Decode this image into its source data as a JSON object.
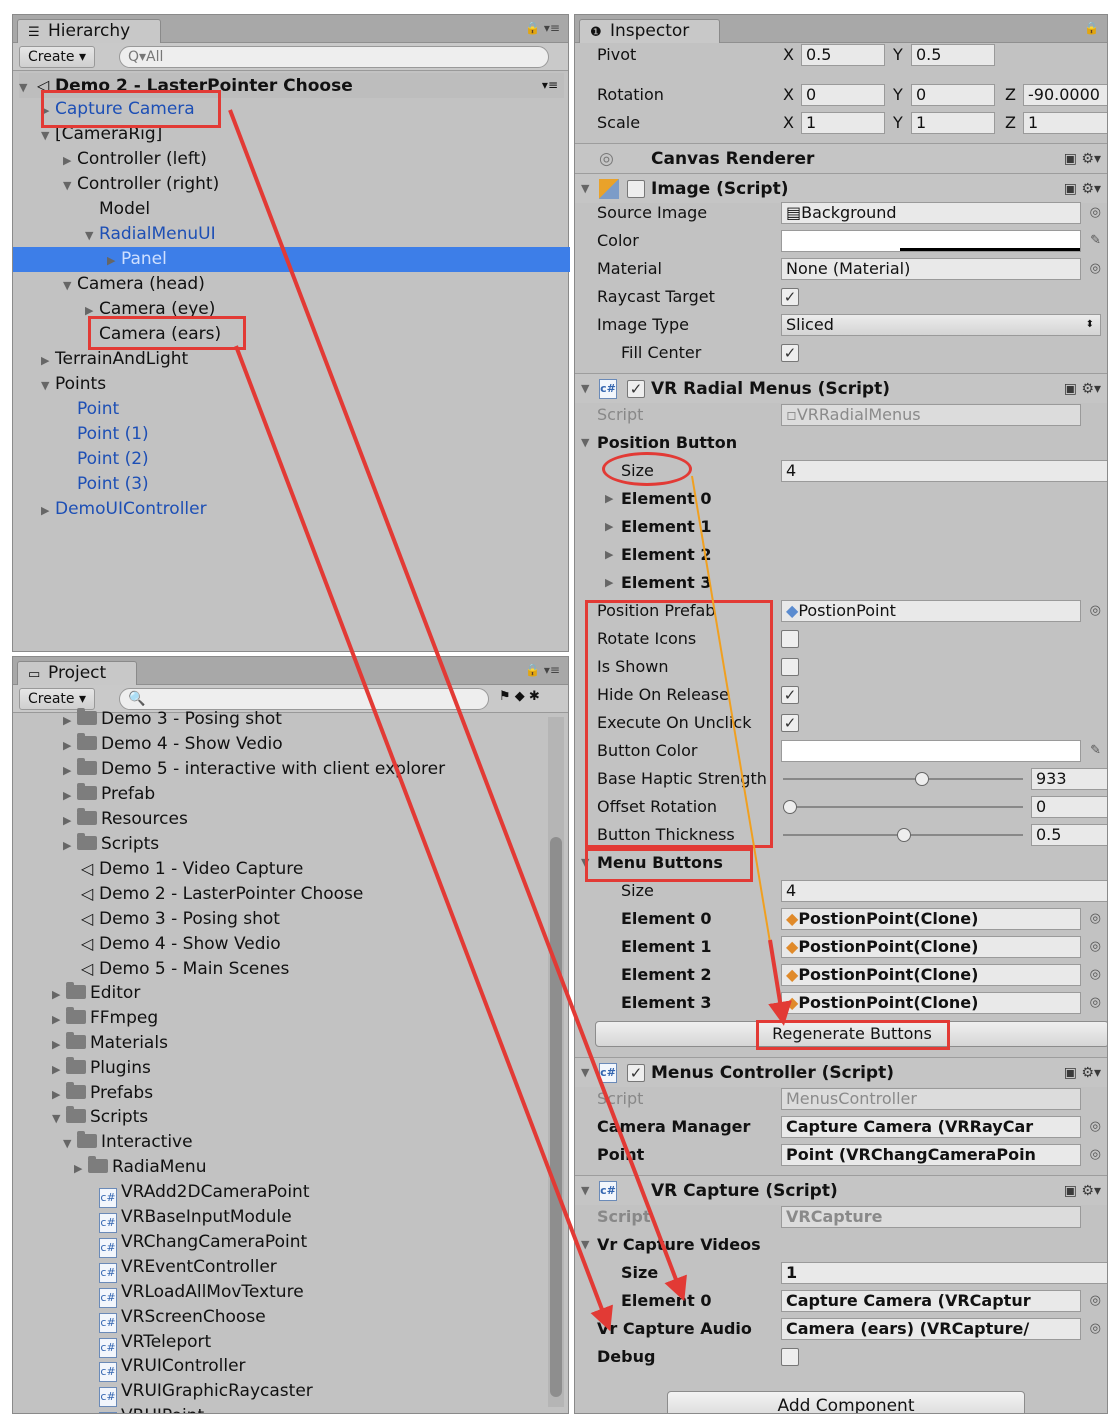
{
  "hierarchy": {
    "tab_label": "Hierarchy",
    "create_label": "Create",
    "search_placeholder": "Q▾All",
    "scene_title": "Demo 2 - LasterPointer Choose",
    "items": [
      {
        "label": "Capture Camera",
        "blue": true
      },
      {
        "label": "[CameraRig]"
      },
      {
        "label": "Controller (left)"
      },
      {
        "label": "Controller (right)"
      },
      {
        "label": "Model"
      },
      {
        "label": "RadialMenuUI",
        "blue": true
      },
      {
        "label": "Panel",
        "blue": true,
        "selected": true
      },
      {
        "label": "Camera (head)"
      },
      {
        "label": "Camera (eye)"
      },
      {
        "label": "Camera (ears)"
      },
      {
        "label": "TerrainAndLight"
      },
      {
        "label": "Points"
      },
      {
        "label": "Point",
        "blue": true
      },
      {
        "label": "Point (1)",
        "blue": true
      },
      {
        "label": "Point (2)",
        "blue": true
      },
      {
        "label": "Point (3)",
        "blue": true
      },
      {
        "label": "DemoUIController",
        "blue": true
      }
    ]
  },
  "project": {
    "tab_label": "Project",
    "create_label": "Create",
    "items": [
      {
        "label": "Demo 3 - Posing shot"
      },
      {
        "label": "Demo 4 - Show Vedio"
      },
      {
        "label": "Demo 5 -  interactive with client explorer"
      },
      {
        "label": "Prefab"
      },
      {
        "label": "Resources"
      },
      {
        "label": "Scripts"
      },
      {
        "label": "Demo 1 - Video Capture"
      },
      {
        "label": "Demo 2 - LasterPointer Choose"
      },
      {
        "label": "Demo 3 - Posing shot"
      },
      {
        "label": "Demo 4 - Show Vedio"
      },
      {
        "label": "Demo 5 -  Main Scenes"
      },
      {
        "label": "Editor"
      },
      {
        "label": "FFmpeg"
      },
      {
        "label": "Materials"
      },
      {
        "label": "Plugins"
      },
      {
        "label": "Prefabs"
      },
      {
        "label": "Scripts"
      },
      {
        "label": "Interactive"
      },
      {
        "label": "RadiaMenu"
      },
      {
        "label": "VRAdd2DCameraPoint"
      },
      {
        "label": "VRBaseInputModule"
      },
      {
        "label": "VRChangCameraPoint"
      },
      {
        "label": "VREventController"
      },
      {
        "label": "VRLoadAllMovTexture"
      },
      {
        "label": "VRScreenChoose"
      },
      {
        "label": "VRTeleport"
      },
      {
        "label": "VRUIController"
      },
      {
        "label": "VRUIGraphicRaycaster"
      },
      {
        "label": "VRUIPoint"
      }
    ]
  },
  "inspector": {
    "tab_label": "Inspector",
    "pivot": {
      "label": "Pivot",
      "x": "0.5",
      "y": "0.5"
    },
    "rotation": {
      "label": "Rotation",
      "x": "0",
      "y": "0",
      "z": "-90.0000"
    },
    "scale": {
      "label": "Scale",
      "x": "1",
      "y": "1",
      "z": "1"
    },
    "axis": {
      "x": "X",
      "y": "Y",
      "z": "Z"
    },
    "canvas_renderer": "Canvas Renderer",
    "image": {
      "title": "Image (Script)",
      "source_image_label": "Source Image",
      "source_image": "Background",
      "color_label": "Color",
      "material_label": "Material",
      "material": "None (Material)",
      "raycast_label": "Raycast Target",
      "image_type_label": "Image Type",
      "image_type": "Sliced",
      "fill_center_label": "Fill Center"
    },
    "radial": {
      "title": "VR Radial Menus (Script)",
      "script_label": "Script",
      "script": "VRRadialMenus",
      "position_button": "Position Button",
      "size_label": "Size",
      "size": "4",
      "elements": [
        "Element 0",
        "Element 1",
        "Element 2",
        "Element 3"
      ],
      "position_prefab_label": "Position Prefab",
      "position_prefab": "PostionPoint",
      "rotate_icons": "Rotate Icons",
      "is_shown": "Is Shown",
      "hide_on_release": "Hide On Release",
      "execute_on_unclick": "Execute On Unclick",
      "button_color": "Button Color",
      "base_haptic_label": "Base Haptic Strength",
      "base_haptic": "933",
      "offset_rotation_label": "Offset Rotation",
      "offset_rotation": "0",
      "button_thickness_label": "Button Thickness",
      "button_thickness": "0.5",
      "menu_buttons": "Menu Buttons",
      "menu_size_label": "Size",
      "menu_size": "4",
      "menu_elements": [
        {
          "label": "Element 0",
          "value": "PostionPoint(Clone)"
        },
        {
          "label": "Element 1",
          "value": "PostionPoint(Clone)"
        },
        {
          "label": "Element 2",
          "value": "PostionPoint(Clone)"
        },
        {
          "label": "Element 3",
          "value": "PostionPoint(Clone)"
        }
      ],
      "regenerate": "Regenerate Buttons"
    },
    "menus_controller": {
      "title": "Menus Controller (Script)",
      "script_label": "Script",
      "script": "MenusController",
      "camera_manager_label": "Camera Manager",
      "camera_manager": "Capture Camera (VRRayCar",
      "point_label": "Point",
      "point": "Point (VRChangCameraPoin"
    },
    "vr_capture": {
      "title": "VR Capture (Script)",
      "script_label": "Script",
      "script": "VRCapture",
      "videos_label": "Vr Capture Videos",
      "size_label": "Size",
      "size": "1",
      "element0_label": "Element 0",
      "element0": "Capture Camera (VRCaptur",
      "audio_label": "Vr Capture Audio",
      "audio": "Camera (ears) (VRCapture/",
      "debug_label": "Debug"
    },
    "add_component": "Add Component"
  },
  "colors": {
    "annotation": "#e23a35",
    "selection": "#3d7ee8",
    "link_blue": "#1d4fb5"
  }
}
